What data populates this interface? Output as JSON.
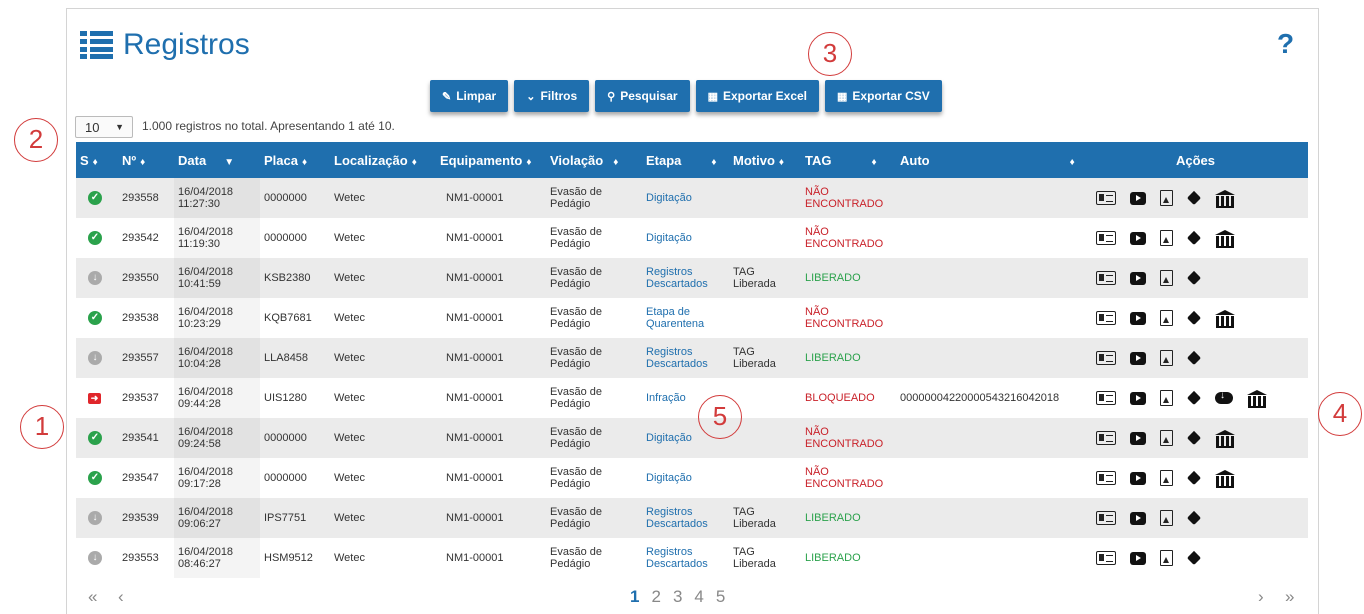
{
  "page": {
    "title": "Registros",
    "help": "?"
  },
  "toolbar": {
    "limpar": "Limpar",
    "filtros": "Filtros",
    "pesquisar": "Pesquisar",
    "exportar_excel": "Exportar Excel",
    "exportar_csv": "Exportar CSV"
  },
  "page_size": "10",
  "summary": "1.000 registros no total. Apresentando 1 até 10.",
  "columns": [
    "S",
    "Nº",
    "Data",
    "Placa",
    "Localização",
    "Equipamento",
    "Violação",
    "Etapa",
    "Motivo",
    "TAG",
    "Auto",
    "Ações"
  ],
  "rows": [
    {
      "status": "ok",
      "numero": "293558",
      "data": "16/04/2018",
      "hora": "11:27:30",
      "placa": "0000000",
      "local": "Wetec",
      "equip": "NM1-00001",
      "violacao": [
        "Evasão de",
        "Pedágio"
      ],
      "etapa": [
        "Digitação"
      ],
      "motivo": [
        "",
        ""
      ],
      "tag": [
        "NÃO",
        "ENCONTRADO"
      ],
      "tag_color": "red",
      "auto": "",
      "acoes": [
        "card",
        "play",
        "img",
        "tag",
        "bank"
      ]
    },
    {
      "status": "ok",
      "numero": "293542",
      "data": "16/04/2018",
      "hora": "11:19:30",
      "placa": "0000000",
      "local": "Wetec",
      "equip": "NM1-00001",
      "violacao": [
        "Evasão de",
        "Pedágio"
      ],
      "etapa": [
        "Digitação"
      ],
      "motivo": [
        "",
        ""
      ],
      "tag": [
        "NÃO",
        "ENCONTRADO"
      ],
      "tag_color": "red",
      "auto": "",
      "acoes": [
        "card",
        "play",
        "img",
        "tag",
        "bank"
      ]
    },
    {
      "status": "grey",
      "numero": "293550",
      "data": "16/04/2018",
      "hora": "10:41:59",
      "placa": "KSB2380",
      "local": "Wetec",
      "equip": "NM1-00001",
      "violacao": [
        "Evasão de",
        "Pedágio"
      ],
      "etapa": [
        "Registros",
        "Descartados"
      ],
      "motivo": [
        "TAG",
        "Liberada"
      ],
      "tag": [
        "LIBERADO"
      ],
      "tag_color": "green",
      "auto": "",
      "acoes": [
        "card",
        "play",
        "img",
        "tag"
      ]
    },
    {
      "status": "ok",
      "numero": "293538",
      "data": "16/04/2018",
      "hora": "10:23:29",
      "placa": "KQB7681",
      "local": "Wetec",
      "equip": "NM1-00001",
      "violacao": [
        "Evasão de",
        "Pedágio"
      ],
      "etapa": [
        "Etapa de",
        "Quarentena"
      ],
      "motivo": [
        "",
        ""
      ],
      "tag": [
        "NÃO",
        "ENCONTRADO"
      ],
      "tag_color": "red",
      "auto": "",
      "acoes": [
        "card",
        "play",
        "img",
        "tag",
        "bank"
      ]
    },
    {
      "status": "grey",
      "numero": "293557",
      "data": "16/04/2018",
      "hora": "10:04:28",
      "placa": "LLA8458",
      "local": "Wetec",
      "equip": "NM1-00001",
      "violacao": [
        "Evasão de",
        "Pedágio"
      ],
      "etapa": [
        "Registros",
        "Descartados"
      ],
      "motivo": [
        "TAG",
        "Liberada"
      ],
      "tag": [
        "LIBERADO"
      ],
      "tag_color": "green",
      "auto": "",
      "acoes": [
        "card",
        "play",
        "img",
        "tag"
      ]
    },
    {
      "status": "exit",
      "numero": "293537",
      "data": "16/04/2018",
      "hora": "09:44:28",
      "placa": "UIS1280",
      "local": "Wetec",
      "equip": "NM1-00001",
      "violacao": [
        "Evasão de",
        "Pedágio"
      ],
      "etapa": [
        "Infração"
      ],
      "motivo": [
        "",
        ""
      ],
      "tag": [
        "BLOQUEADO"
      ],
      "tag_color": "red",
      "auto": "00000004220000543216042018",
      "acoes": [
        "card",
        "play",
        "img",
        "tag",
        "cloud",
        "bank"
      ]
    },
    {
      "status": "ok",
      "numero": "293541",
      "data": "16/04/2018",
      "hora": "09:24:58",
      "placa": "0000000",
      "local": "Wetec",
      "equip": "NM1-00001",
      "violacao": [
        "Evasão de",
        "Pedágio"
      ],
      "etapa": [
        "Digitação"
      ],
      "motivo": [
        "",
        ""
      ],
      "tag": [
        "NÃO",
        "ENCONTRADO"
      ],
      "tag_color": "red",
      "auto": "",
      "acoes": [
        "card",
        "play",
        "img",
        "tag",
        "bank"
      ]
    },
    {
      "status": "ok",
      "numero": "293547",
      "data": "16/04/2018",
      "hora": "09:17:28",
      "placa": "0000000",
      "local": "Wetec",
      "equip": "NM1-00001",
      "violacao": [
        "Evasão de",
        "Pedágio"
      ],
      "etapa": [
        "Digitação"
      ],
      "motivo": [
        "",
        ""
      ],
      "tag": [
        "NÃO",
        "ENCONTRADO"
      ],
      "tag_color": "red",
      "auto": "",
      "acoes": [
        "card",
        "play",
        "img",
        "tag",
        "bank"
      ]
    },
    {
      "status": "grey",
      "numero": "293539",
      "data": "16/04/2018",
      "hora": "09:06:27",
      "placa": "IPS7751",
      "local": "Wetec",
      "equip": "NM1-00001",
      "violacao": [
        "Evasão de",
        "Pedágio"
      ],
      "etapa": [
        "Registros",
        "Descartados"
      ],
      "motivo": [
        "TAG",
        "Liberada"
      ],
      "tag": [
        "LIBERADO"
      ],
      "tag_color": "green",
      "auto": "",
      "acoes": [
        "card",
        "play",
        "img",
        "tag"
      ]
    },
    {
      "status": "grey",
      "numero": "293553",
      "data": "16/04/2018",
      "hora": "08:46:27",
      "placa": "HSM9512",
      "local": "Wetec",
      "equip": "NM1-00001",
      "violacao": [
        "Evasão de",
        "Pedágio"
      ],
      "etapa": [
        "Registros",
        "Descartados"
      ],
      "motivo": [
        "TAG",
        "Liberada"
      ],
      "tag": [
        "LIBERADO"
      ],
      "tag_color": "green",
      "auto": "",
      "acoes": [
        "card",
        "play",
        "img",
        "tag"
      ]
    }
  ],
  "pagination": {
    "first": "«",
    "prev": "‹",
    "pages": [
      "1",
      "2",
      "3",
      "4",
      "5"
    ],
    "current": "1",
    "next": "›",
    "last": "»"
  },
  "callouts": [
    "1",
    "2",
    "3",
    "4",
    "5"
  ],
  "colors": {
    "primary": "#1f6fae",
    "ok": "#2ba24c",
    "alert": "#c9222a",
    "callout": "#d23b3b"
  }
}
